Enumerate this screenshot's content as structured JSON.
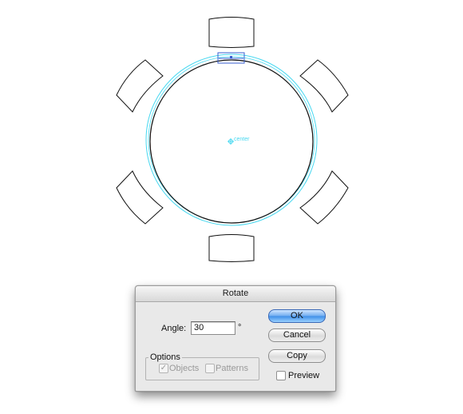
{
  "canvas": {
    "center_label": "center"
  },
  "dialog": {
    "title": "Rotate",
    "angle": {
      "label": "Angle:",
      "value": "30",
      "unit": "°"
    },
    "options": {
      "legend": "Options",
      "objects": {
        "label": "Objects",
        "checked": true,
        "enabled": false,
        "glyph": "✓"
      },
      "patterns": {
        "label": "Patterns",
        "checked": false,
        "enabled": false
      }
    },
    "buttons": {
      "ok": "OK",
      "cancel": "Cancel",
      "copy": "Copy"
    },
    "preview": {
      "label": "Preview",
      "checked": false
    }
  },
  "colors": {
    "guide": "#47d8f0",
    "selection": "#3a5fd0",
    "ok_button": "#3d8ee8"
  }
}
